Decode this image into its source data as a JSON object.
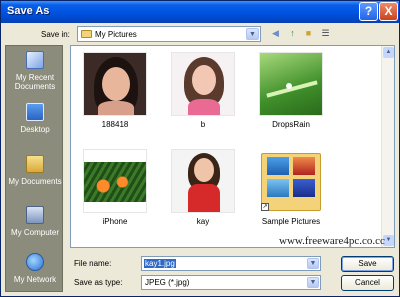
{
  "window": {
    "title": "Save As",
    "help_label": "?",
    "close_label": "X"
  },
  "location": {
    "label": "Save in:",
    "value": "My Pictures"
  },
  "places": [
    {
      "label": "My Recent Documents",
      "icon": "recent-documents-icon"
    },
    {
      "label": "Desktop",
      "icon": "desktop-icon"
    },
    {
      "label": "My Documents",
      "icon": "my-documents-icon"
    },
    {
      "label": "My Computer",
      "icon": "my-computer-icon"
    },
    {
      "label": "My Network",
      "icon": "network-icon"
    }
  ],
  "files": [
    {
      "name": "188418"
    },
    {
      "name": "b"
    },
    {
      "name": "DropsRain"
    },
    {
      "name": "iPhone"
    },
    {
      "name": "kay"
    },
    {
      "name": "Sample Pictures"
    }
  ],
  "watermark": "www.freeware4pc.co.cc",
  "form": {
    "filename_label": "File name:",
    "filename_value": "kay1.jpg",
    "savetype_label": "Save as type:",
    "savetype_value": "JPEG (*.jpg)"
  },
  "buttons": {
    "save": "Save",
    "cancel": "Cancel"
  },
  "colors": {
    "titlebar": "#0054e3",
    "dialog_bg": "#ece9d8",
    "places_bar": "#8c8c7c",
    "selection": "#316ac5"
  }
}
